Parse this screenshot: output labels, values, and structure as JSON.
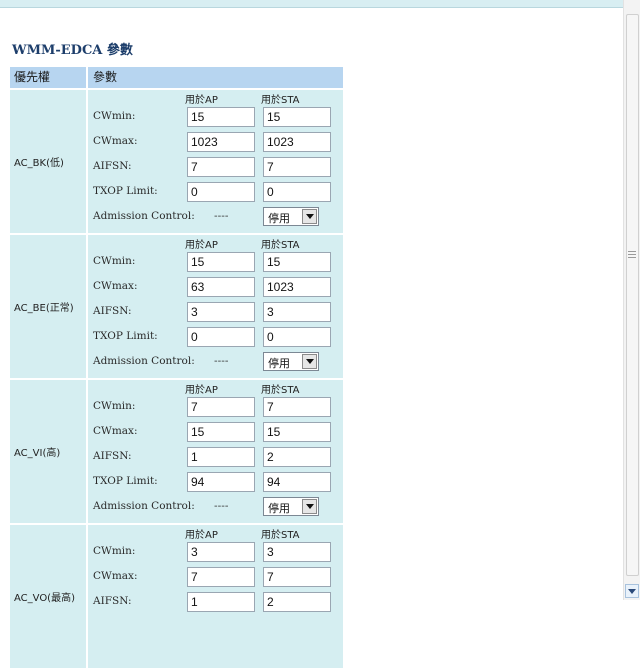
{
  "page": {
    "title": "WMM-EDCA 參數"
  },
  "table": {
    "header_priority": "優先權",
    "header_params": "參數",
    "col_ap": "用於AP",
    "col_sta": "用於STA",
    "labels": {
      "cwmin": "CWmin:",
      "cwmax": "CWmax:",
      "aifsn": "AIFSN:",
      "txop": "TXOP Limit:",
      "admission": "Admission Control:"
    },
    "groups": [
      {
        "name": "AC_BK(低)",
        "cwmin": {
          "ap": "15",
          "sta": "15"
        },
        "cwmax": {
          "ap": "1023",
          "sta": "1023"
        },
        "aifsn": {
          "ap": "7",
          "sta": "7"
        },
        "txop": {
          "ap": "0",
          "sta": "0"
        },
        "admission": {
          "ap": "----",
          "sta": "停用"
        }
      },
      {
        "name": "AC_BE(正常)",
        "cwmin": {
          "ap": "15",
          "sta": "15"
        },
        "cwmax": {
          "ap": "63",
          "sta": "1023"
        },
        "aifsn": {
          "ap": "3",
          "sta": "3"
        },
        "txop": {
          "ap": "0",
          "sta": "0"
        },
        "admission": {
          "ap": "----",
          "sta": "停用"
        }
      },
      {
        "name": "AC_VI(高)",
        "cwmin": {
          "ap": "7",
          "sta": "7"
        },
        "cwmax": {
          "ap": "15",
          "sta": "15"
        },
        "aifsn": {
          "ap": "1",
          "sta": "2"
        },
        "txop": {
          "ap": "94",
          "sta": "94"
        },
        "admission": {
          "ap": "----",
          "sta": "停用"
        }
      },
      {
        "name": "AC_VO(最高)",
        "cwmin": {
          "ap": "3",
          "sta": "3"
        },
        "cwmax": {
          "ap": "7",
          "sta": "7"
        },
        "aifsn": {
          "ap": "1",
          "sta": "2"
        }
      }
    ]
  },
  "colors": {
    "row_bg": "#d5eef1",
    "header_bg": "#b7d5f0",
    "title": "#1d3e6b"
  },
  "icons": {
    "dropdown": "chevron-down-icon",
    "scroll_down": "scroll-down-arrow-icon"
  }
}
